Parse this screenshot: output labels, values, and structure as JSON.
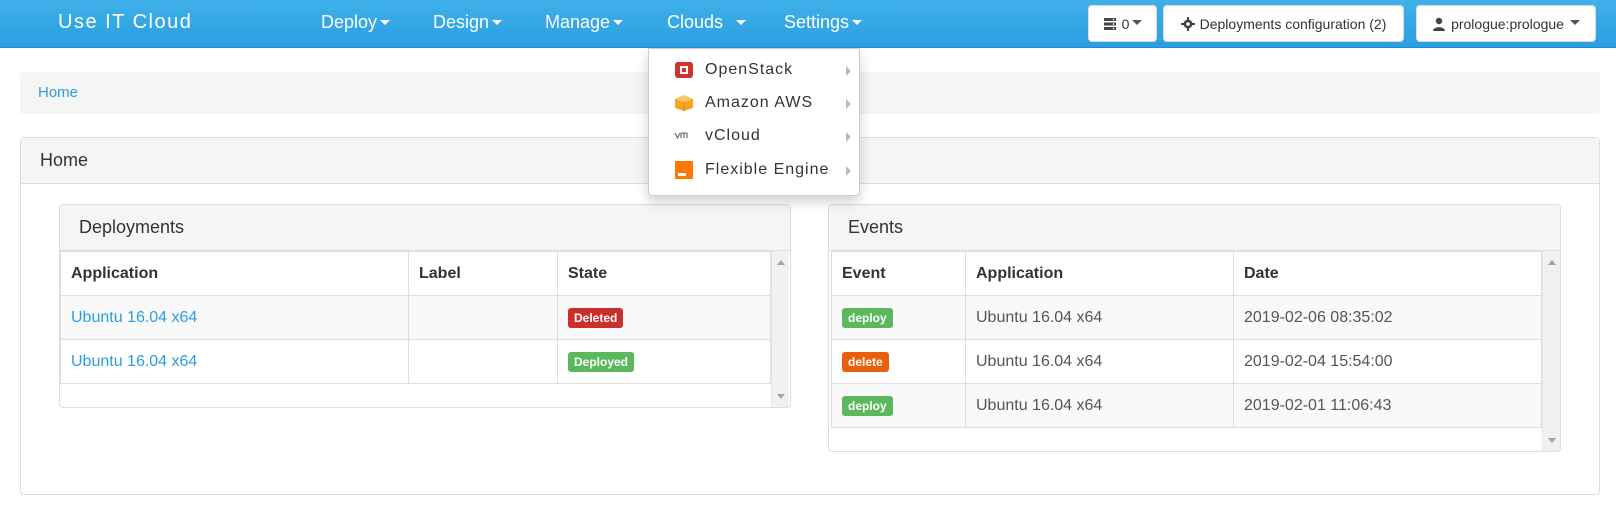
{
  "navbar": {
    "brand": "Use IT Cloud",
    "menus": [
      {
        "label": "Deploy"
      },
      {
        "label": "Design"
      },
      {
        "label": "Manage"
      },
      {
        "label": "Clouds"
      },
      {
        "label": "Settings"
      }
    ],
    "queue_count": "0",
    "config_button": "Deployments configuration (2)",
    "user_button": "prologue:prologue"
  },
  "clouds_dropdown": {
    "items": [
      {
        "label": "OpenStack",
        "icon": "openstack-icon"
      },
      {
        "label": "Amazon AWS",
        "icon": "aws-icon"
      },
      {
        "label": "vCloud",
        "icon": "vmware-icon"
      },
      {
        "label": "Flexible Engine",
        "icon": "flexible-engine-icon"
      }
    ]
  },
  "breadcrumb": {
    "home": "Home"
  },
  "home_panel": {
    "title": "Home"
  },
  "deployments": {
    "title": "Deployments",
    "columns": [
      "Application",
      "Label",
      "State"
    ],
    "rows": [
      {
        "application": "Ubuntu 16.04 x64",
        "label": "",
        "state": "Deleted",
        "state_color": "#c9302c"
      },
      {
        "application": "Ubuntu 16.04 x64",
        "label": "",
        "state": "Deployed",
        "state_color": "#5cb85c"
      }
    ]
  },
  "events": {
    "title": "Events",
    "columns": [
      "Event",
      "Application",
      "Date"
    ],
    "rows": [
      {
        "event": "deploy",
        "event_color": "#5cb85c",
        "application": "Ubuntu 16.04 x64",
        "date": "2019-02-06 08:35:02"
      },
      {
        "event": "delete",
        "event_color": "#e8600b",
        "application": "Ubuntu 16.04 x64",
        "date": "2019-02-04 15:54:00"
      },
      {
        "event": "deploy",
        "event_color": "#5cb85c",
        "application": "Ubuntu 16.04 x64",
        "date": "2019-02-01 11:06:43"
      }
    ]
  },
  "colors": {
    "navbar": "#2a9fe0",
    "link": "#2a9fe0"
  }
}
